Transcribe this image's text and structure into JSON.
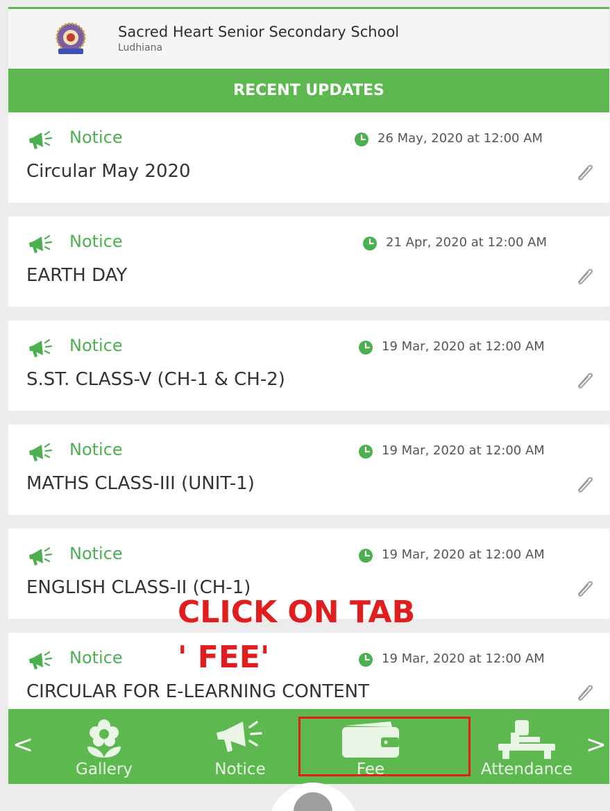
{
  "header": {
    "school_name": "Sacred Heart Senior Secondary School",
    "school_city": "Ludhiana"
  },
  "banner": {
    "title": "RECENT UPDATES"
  },
  "updates": [
    {
      "type": "Notice",
      "date": "26 May, 2020 at 12:00 AM",
      "title": "Circular May 2020"
    },
    {
      "type": "Notice",
      "date": "21 Apr, 2020 at 12:00 AM",
      "title": "EARTH DAY"
    },
    {
      "type": "Notice",
      "date": "19 Mar, 2020 at 12:00 AM",
      "title": "S.ST. CLASS-V (CH-1 & CH-2)"
    },
    {
      "type": "Notice",
      "date": "19 Mar, 2020 at 12:00 AM",
      "title": "MATHS CLASS-III (UNIT-1)"
    },
    {
      "type": "Notice",
      "date": "19 Mar, 2020 at 12:00 AM",
      "title": "ENGLISH CLASS-II (CH-1)"
    },
    {
      "type": "Notice",
      "date": "19 Mar, 2020 at 12:00 AM",
      "title": "CIRCULAR FOR E-LEARNING CONTENT"
    }
  ],
  "annotation": {
    "line1": "CLICK ON  TAB",
    "line2": "' FEE'"
  },
  "bottom_nav": {
    "prev_arrow": "<",
    "next_arrow": ">",
    "tabs": [
      {
        "label": "Gallery",
        "icon": "flower-icon"
      },
      {
        "label": "Notice",
        "icon": "megaphone-icon"
      },
      {
        "label": "Fee",
        "icon": "wallet-icon"
      },
      {
        "label": "Attendance",
        "icon": "desk-icon"
      }
    ]
  },
  "colors": {
    "brand_green": "#5cb84f",
    "notice_green": "#4caf50",
    "annotation_red": "#e11d1d"
  }
}
